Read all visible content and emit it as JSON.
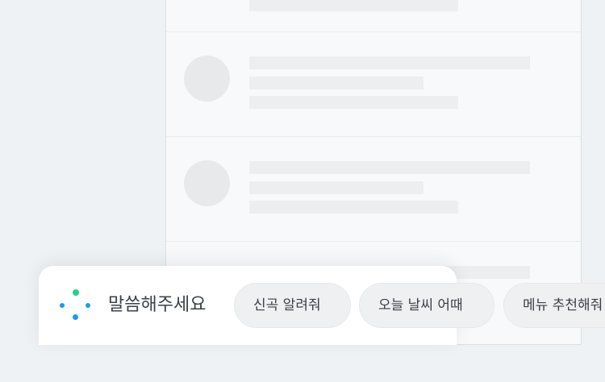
{
  "assistant": {
    "prompt": "말씀해주세요",
    "icon": "assistant-dots-icon",
    "colors": {
      "dot_green": "#1fd18a",
      "dot_blue": "#1a9bf0"
    },
    "suggestions": [
      {
        "label": "신곡 알려줘"
      },
      {
        "label": "오늘 날씨 어때"
      },
      {
        "label": "메뉴 추천해줘"
      }
    ]
  },
  "list": {
    "placeholder_rows": 3
  }
}
